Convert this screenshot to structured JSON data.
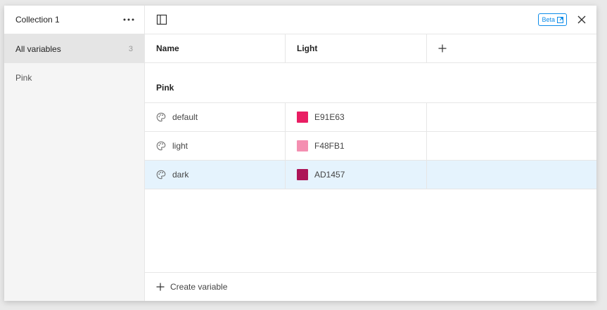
{
  "sidebar": {
    "collection_title": "Collection 1",
    "items": [
      {
        "label": "All variables",
        "count": "3"
      },
      {
        "label": "Pink"
      }
    ]
  },
  "topbar": {
    "beta_label": "Beta"
  },
  "table": {
    "headers": {
      "name": "Name",
      "mode": "Light"
    },
    "group_label": "Pink",
    "rows": [
      {
        "name": "default",
        "hex": "E91E63",
        "color": "#E91E63"
      },
      {
        "name": "light",
        "hex": "F48FB1",
        "color": "#F48FB1"
      },
      {
        "name": "dark",
        "hex": "AD1457",
        "color": "#AD1457"
      }
    ]
  },
  "footer": {
    "create_label": "Create variable"
  },
  "colors": {
    "accent": "#0c8ce9",
    "selected_row": "#e5f3fd"
  }
}
